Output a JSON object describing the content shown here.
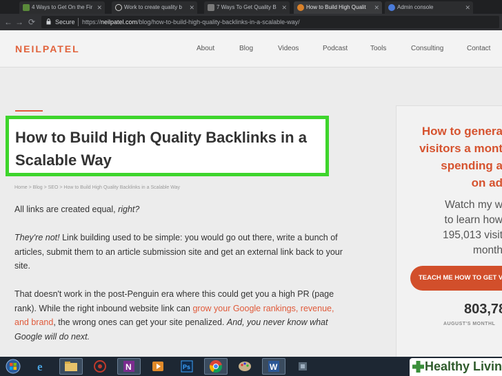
{
  "browser": {
    "tabs": [
      {
        "label": "4 Ways to Get On the Fir",
        "favicon_color": "#5a8a3a"
      },
      {
        "label": "Work to create quality b",
        "favicon_color": "#9aa0a6"
      },
      {
        "label": "7 Ways To Get Quality B",
        "favicon_color": "#8a8a8a"
      },
      {
        "label": "How to Build High Qualit",
        "favicon_color": "#d9812a"
      },
      {
        "label": "Admin console",
        "favicon_color": "#4a7bd9"
      }
    ],
    "secure_label": "Secure",
    "url_scheme": "https://",
    "url_host": "neilpatel.com",
    "url_path": "/blog/how-to-build-high-quality-backlinks-in-a-scalable-way/"
  },
  "site": {
    "logo": "NEILPATEL",
    "nav": [
      "About",
      "Blog",
      "Videos",
      "Podcast",
      "Tools",
      "Consulting",
      "Contact"
    ]
  },
  "article": {
    "title": "How to Build High Quality Backlinks in a Scalable Way",
    "breadcrumb": "Home > Blog > SEO > How to Build High Quality Backlinks in a Scalable Way",
    "p1_text": "All links are created equal, ",
    "p1_em": "right?",
    "p2_em": "They're not!",
    "p2_text": " Link building used to be simple: you would go out there, write a bunch of articles, submit them to an article submission site and get an external link back to your site.",
    "p3_text_a": "That doesn't work in the post-Penguin era where this could get you a high PR (page rank). While the right inbound website link can ",
    "p3_link": "grow your Google rankings, revenue, and brand",
    "p3_text_b": ", the wrong ones can get your site penalized. ",
    "p3_em": "And, you never know what Google will do next."
  },
  "sidebar": {
    "headline": [
      "How to genera",
      "visitors a mont",
      "spending a",
      "on ad"
    ],
    "subtext": [
      "Watch my w",
      "to learn how",
      "195,013 visit",
      "month"
    ],
    "button": "TEACH ME HOW TO GET V",
    "count": "803,78",
    "caption": "AUGUST'S MONTHL"
  },
  "taskbar": {
    "items": [
      "start-orb",
      "internet-explorer",
      "file-explorer",
      "music-app",
      "onenote",
      "media-player",
      "photoshop",
      "chrome",
      "paint",
      "word",
      "tool"
    ]
  },
  "watermark": {
    "text": "Healthy Living"
  },
  "colors": {
    "accent": "#e05a3a",
    "highlight": "#3ed52c"
  }
}
